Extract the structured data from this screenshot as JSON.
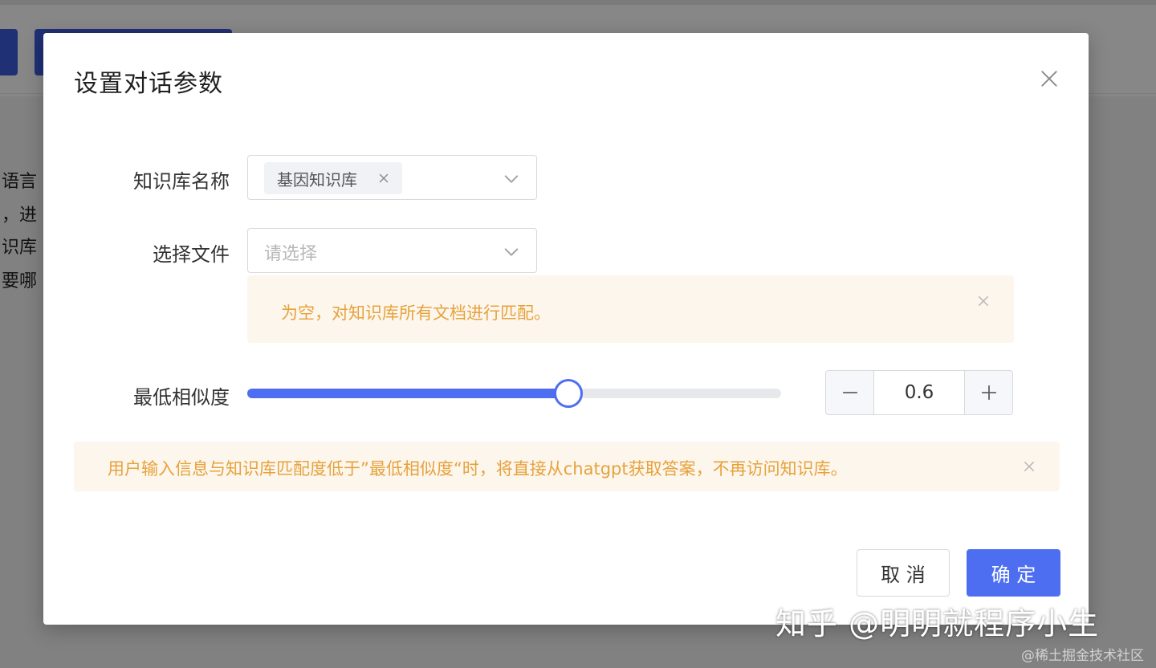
{
  "background": {
    "text_lines": [
      "语言",
      "，进",
      "识库",
      "要哪"
    ]
  },
  "modal": {
    "title": "设置对话参数",
    "close_icon": "close-icon",
    "knowledge_base": {
      "label": "知识库名称",
      "selected_tags": [
        "基因知识库"
      ]
    },
    "file_select": {
      "label": "选择文件",
      "placeholder": "请选择"
    },
    "file_alert": {
      "text": "为空，对知识库所有文档进行匹配。"
    },
    "similarity": {
      "label": "最低相似度",
      "slider_fraction": 0.6,
      "value": "0.6",
      "minus_icon": "minus-icon",
      "plus_icon": "plus-icon"
    },
    "similarity_alert": {
      "text": "用户输入信息与知识库匹配度低于”最低相似度“时，将直接从chatgpt获取答案，不再访问知识库。"
    },
    "buttons": {
      "cancel": "取 消",
      "confirm": "确 定"
    }
  },
  "watermarks": {
    "zhihu": "知乎 @明明就程序小生",
    "juejin": "@稀土掘金技术社区"
  },
  "colors": {
    "primary": "#4e6ef2",
    "warning_text": "#e6a23c",
    "warning_bg": "#fdf6ec"
  }
}
